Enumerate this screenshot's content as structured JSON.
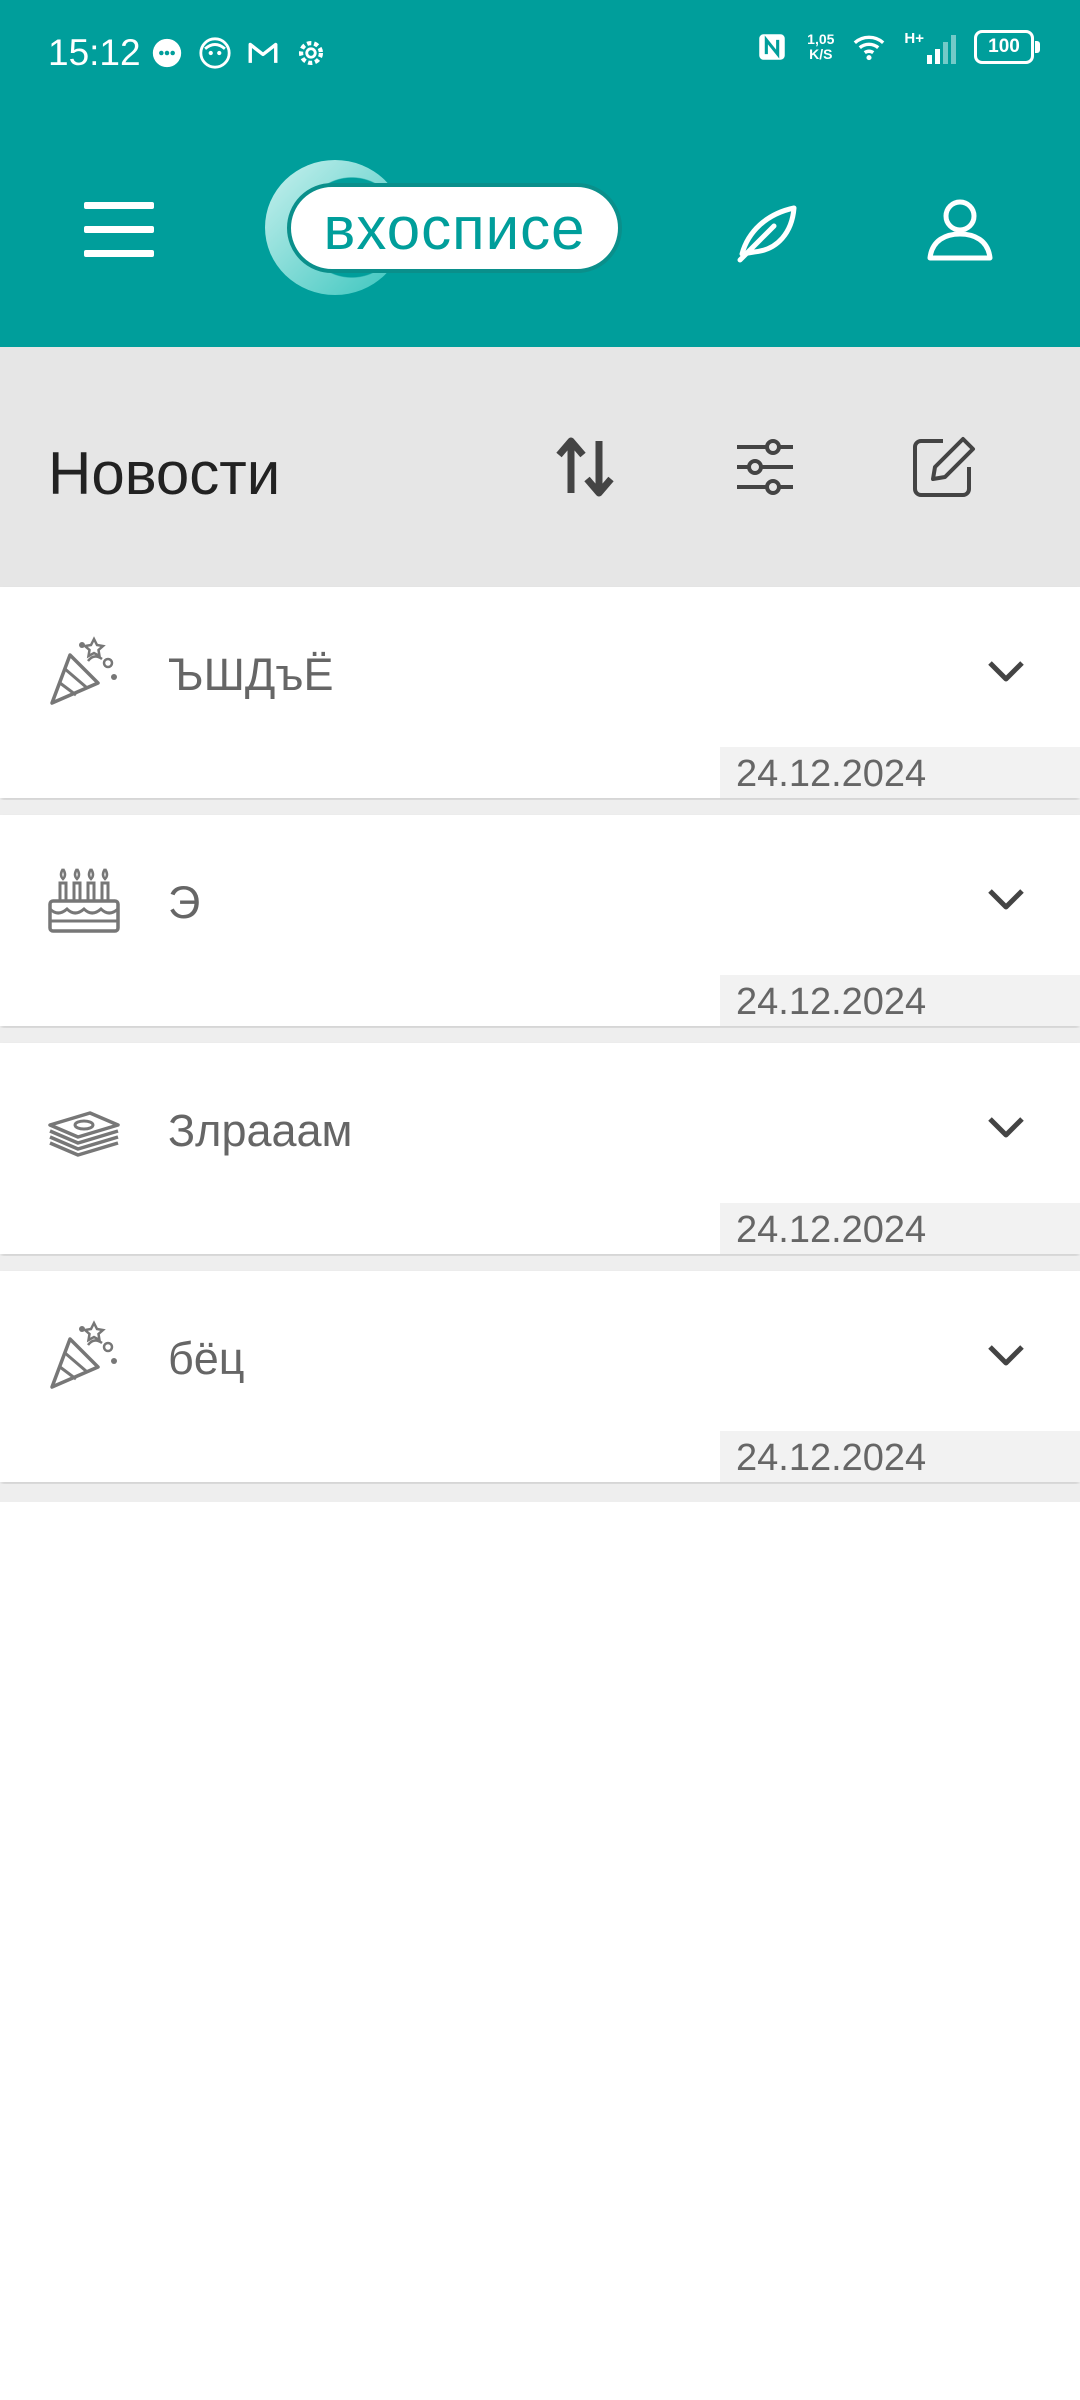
{
  "status_bar": {
    "time": "15:12",
    "net_speed_value": "1,05",
    "net_speed_unit": "K/S",
    "signal_label": "H+",
    "battery": "100"
  },
  "app_bar": {
    "logo_text": "вхосписе"
  },
  "toolbar": {
    "title": "Новости"
  },
  "news": [
    {
      "icon": "party-popper-icon",
      "title": "ЪШДъЁ",
      "date": "24.12.2024"
    },
    {
      "icon": "birthday-cake-icon",
      "title": "Э",
      "date": "24.12.2024"
    },
    {
      "icon": "money-stack-icon",
      "title": "Злрааам",
      "date": "24.12.2024"
    },
    {
      "icon": "party-popper-icon",
      "title": "бёц",
      "date": "24.12.2024"
    }
  ],
  "colors": {
    "header_teal": "#009e9b",
    "toolbar_grey": "#e6e6e6",
    "date_bg": "#f2f2f2"
  }
}
